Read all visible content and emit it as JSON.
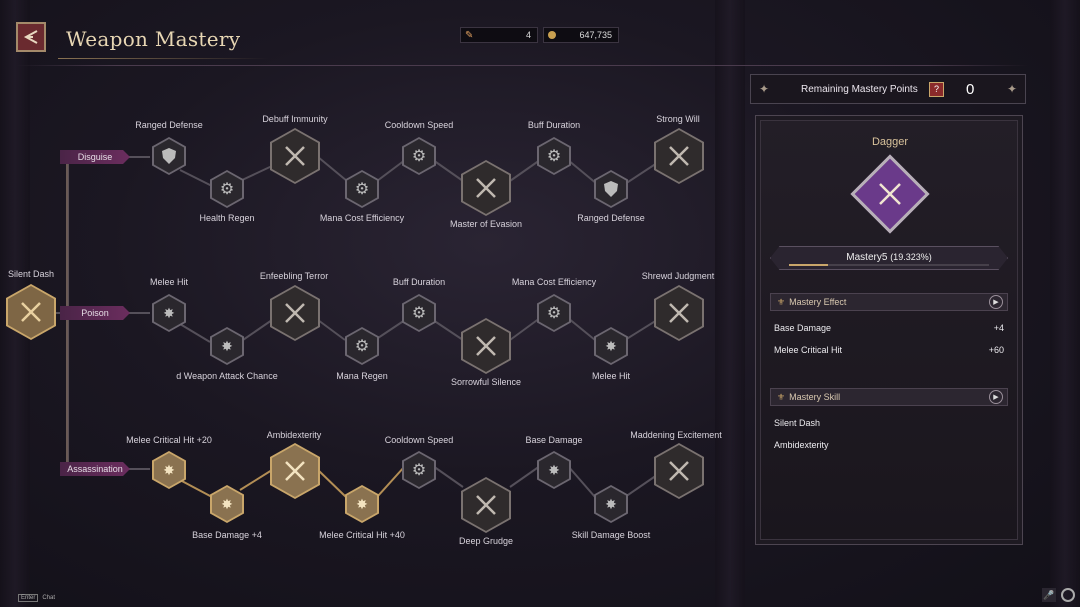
{
  "header": {
    "title": "Weapon Mastery"
  },
  "currency": [
    {
      "icon": "scroll-icon",
      "value": "4"
    },
    {
      "icon": "coin-icon",
      "value": "647,735"
    }
  ],
  "tree": {
    "root": {
      "label": "Silent Dash"
    },
    "branches": [
      {
        "name": "Disguise",
        "nodes": [
          "Ranged Defense",
          "Health Regen",
          "Debuff Immunity",
          "Mana Cost Efficiency",
          "Cooldown Speed",
          "Master of Evasion",
          "Buff Duration",
          "Ranged Defense",
          "Strong Will"
        ]
      },
      {
        "name": "Poison",
        "nodes": [
          "Melee Hit",
          "d Weapon Attack Chance",
          "Enfeebling Terror",
          "Mana Regen",
          "Buff Duration",
          "Sorrowful Silence",
          "Mana Cost Efficiency",
          "Melee Hit",
          "Shrewd Judgment"
        ]
      },
      {
        "name": "Assassination",
        "nodes": [
          "Melee Critical Hit +20",
          "Base Damage +4",
          "Ambidexterity",
          "Melee Critical Hit +40",
          "Cooldown Speed",
          "Deep Grudge",
          "Base Damage",
          "Skill Damage Boost",
          "Maddening Excitement"
        ]
      }
    ]
  },
  "panel": {
    "remaining_label": "Remaining Mastery Points",
    "help_label": "?",
    "remaining_value": "0",
    "weapon": "Dagger",
    "mastery_level": "Mastery5",
    "mastery_percent": "(19.323%)",
    "mastery_progress": 0.19323,
    "effect_title": "Mastery Effect",
    "effects": [
      {
        "name": "Base Damage",
        "value": "+4"
      },
      {
        "name": "Melee Critical Hit",
        "value": "+60"
      }
    ],
    "skill_title": "Mastery Skill",
    "skills": [
      "Silent Dash",
      "Ambidexterity"
    ]
  },
  "footer": {
    "enter_key": "Enter",
    "chat_label": "Chat"
  },
  "colors": {
    "accent_gold": "#c9a66a",
    "branch_tag": "#6b2d5e",
    "progress": "#7a2f8f"
  }
}
